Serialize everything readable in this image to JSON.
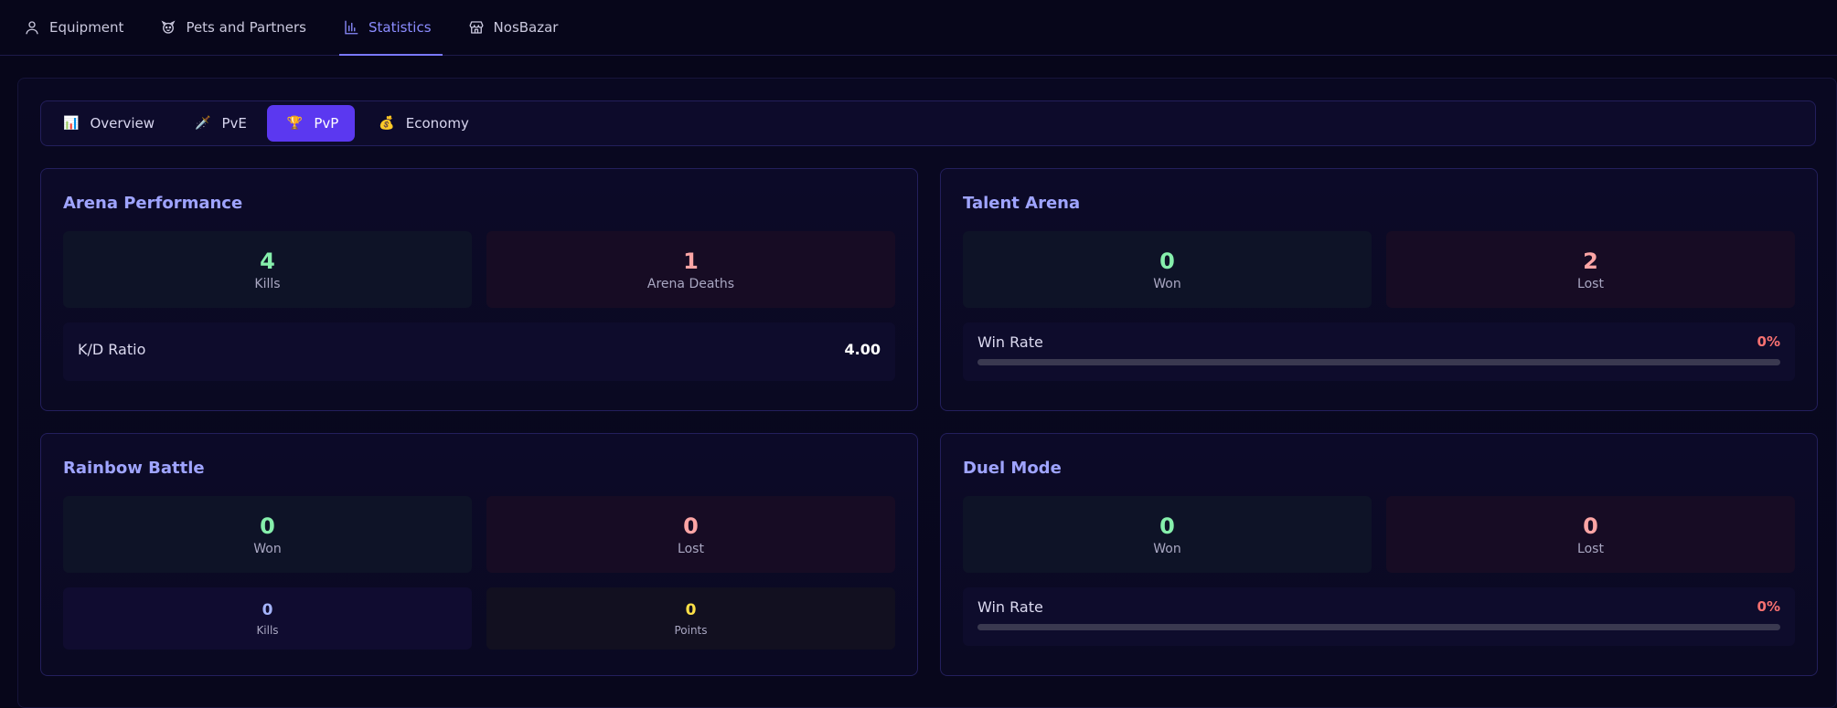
{
  "topnav": {
    "items": [
      {
        "label": "Equipment",
        "icon": "person-icon"
      },
      {
        "label": "Pets and Partners",
        "icon": "pet-icon"
      },
      {
        "label": "Statistics",
        "icon": "bar-chart-icon",
        "active": true
      },
      {
        "label": "NosBazar",
        "icon": "store-icon"
      }
    ]
  },
  "subtabs": {
    "items": [
      {
        "label": "Overview",
        "emoji": "📊"
      },
      {
        "label": "PvE",
        "emoji": "🗡️"
      },
      {
        "label": "PvP",
        "emoji": "🏆",
        "active": true
      },
      {
        "label": "Economy",
        "emoji": "💰"
      }
    ]
  },
  "arena": {
    "title": "Arena Performance",
    "kills": {
      "value": "4",
      "label": "Kills"
    },
    "deaths": {
      "value": "1",
      "label": "Arena Deaths"
    },
    "kd": {
      "label": "K/D Ratio",
      "value": "4.00"
    }
  },
  "talent": {
    "title": "Talent Arena",
    "won": {
      "value": "0",
      "label": "Won"
    },
    "lost": {
      "value": "2",
      "label": "Lost"
    },
    "winrate": {
      "label": "Win Rate",
      "value": "0%",
      "fraction": 0
    }
  },
  "rainbow": {
    "title": "Rainbow Battle",
    "won": {
      "value": "0",
      "label": "Won"
    },
    "lost": {
      "value": "0",
      "label": "Lost"
    },
    "kills": {
      "value": "0",
      "label": "Kills"
    },
    "points": {
      "value": "0",
      "label": "Points"
    }
  },
  "duel": {
    "title": "Duel Mode",
    "won": {
      "value": "0",
      "label": "Won"
    },
    "lost": {
      "value": "0",
      "label": "Lost"
    },
    "winrate": {
      "label": "Win Rate",
      "value": "0%",
      "fraction": 0
    }
  },
  "colors": {
    "accent": "#5b38f0",
    "title": "#9fa4ff",
    "positive": "#86efac",
    "negative": "#fca5a5",
    "winrate": "#f87171"
  }
}
